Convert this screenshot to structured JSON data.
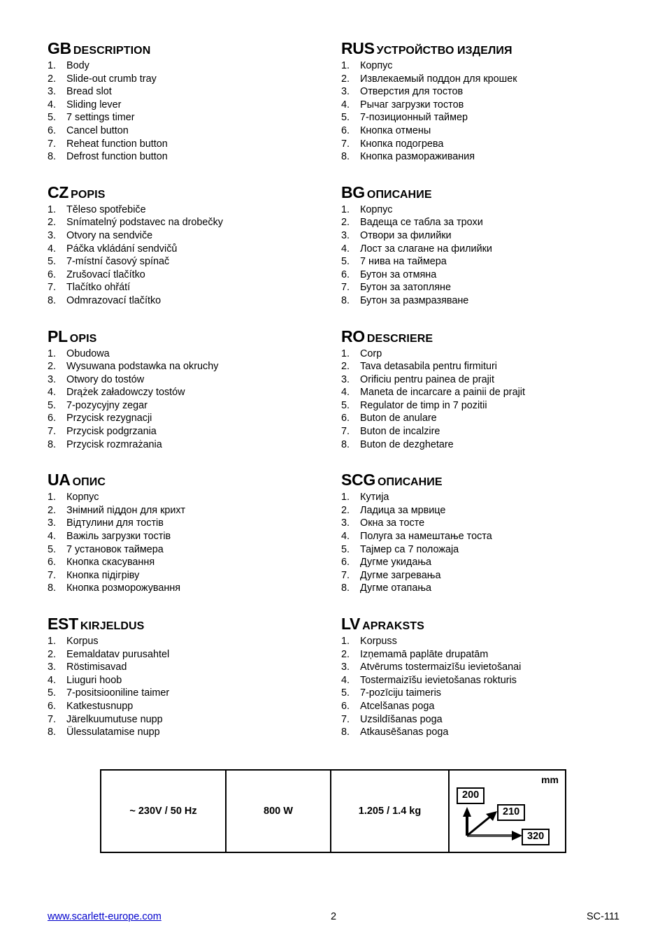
{
  "document": {
    "sections": [
      {
        "code": "GB",
        "title": "DESCRIPTION",
        "items": [
          "Body",
          "Slide-out crumb tray",
          "Bread slot",
          "Sliding lever",
          "7 settings timer",
          "Cancel button",
          "Reheat function button",
          "Defrost function button"
        ]
      },
      {
        "code": "RUS",
        "title": "УСТРОЙСТВО ИЗДЕЛИЯ",
        "items": [
          "Корпус",
          "Извлекаемый поддон для крошек",
          "Отверстия для тостов",
          "Рычаг загрузки тостов",
          "7-позиционный таймер",
          "Кнопка отмены",
          "Кнопка подогрева",
          "Кнопка размораживания"
        ]
      },
      {
        "code": "CZ",
        "title": "POPIS",
        "items": [
          "Těleso spotřebiče",
          "Snímatelný podstavec na drobečky",
          "Otvory na sendviče",
          "Páčka vkládání sendvičů",
          "7-místní časový spínač",
          "Zrušovací tlačítko",
          "Tlačítko ohřátí",
          "Odmrazovací tlačítko"
        ]
      },
      {
        "code": "BG",
        "title": "ОПИСАНИЕ",
        "items": [
          "Корпус",
          "Вадеща се табла за трохи",
          "Отвори за филийки",
          "Лост за слагане на филийки",
          "7 нива на таймера",
          "Бутон за отмяна",
          "Бутон за затопляне",
          "Бутон за размразяване"
        ]
      },
      {
        "code": "PL",
        "title": "OPIS",
        "items": [
          "Obudowa",
          "Wysuwana podstawka na okruchy",
          "Otwory do tostów",
          "Drążek załadowczy tostów",
          "7-pozycyjny zegar",
          "Przycisk rezygnacji",
          "Przycisk podgrzania",
          "Przycisk rozmrażania"
        ]
      },
      {
        "code": "RO",
        "title": "DESCRIERE",
        "items": [
          "Corp",
          "Tava detasabila pentru firmituri",
          "Orificiu pentru painea de prajit",
          "Maneta de incarcare a painii de prajit",
          "Regulator de timp in 7 pozitii",
          "Buton de anulare",
          "Buton de incalzire",
          "Buton de dezghetare"
        ]
      },
      {
        "code": "UA",
        "title": "ОПИС",
        "items": [
          "Корпус",
          "Знімний піддон для крихт",
          "Відтулини для тостів",
          "Важіль загрузки тостів",
          "7 установок таймера",
          "Кнопка скасування",
          "Кнопка підігріву",
          "Кнопка розморожування"
        ]
      },
      {
        "code": "SCG",
        "title": "ОПИСАНИЕ",
        "items": [
          "Кутија",
          "Ладица за мрвице",
          "Окна за тосте",
          "Полуга за намештање тоста",
          "Тајмер са 7 положаја",
          "Дугме укидања",
          "Дугме загревања",
          "Дугме отапања"
        ]
      },
      {
        "code": "EST",
        "title": "KIRJELDUS",
        "items": [
          "Korpus",
          "Eemaldatav purusahtel",
          "Röstimisavad",
          "Liuguri hoob",
          "7-positsiooniline taimer",
          "Katkestusnupp",
          "Järelkuumutuse nupp",
          "Ülessulatamise nupp"
        ]
      },
      {
        "code": "LV",
        "title": "APRAKSTS",
        "items": [
          "Korpuss",
          "Izņemamā paplāte drupatām",
          "Atvērums tostermaizīšu ievietošanai",
          "Tostermaizīšu ievietošanas rokturis",
          "7-pozīciju taimeris",
          "Atcelšanas poga",
          "Uzsildīšanas poga",
          "Atkausēšanas poga"
        ]
      }
    ]
  },
  "spec_table": {
    "voltage": "~ 230V / 50 Hz",
    "power": "800 W",
    "weight": "1.205 / 1.4 kg",
    "dimensions": {
      "unit": "mm",
      "height": "200",
      "depth": "210",
      "width": "320"
    }
  },
  "footer": {
    "url": "www.scarlett-europe.com",
    "page": "2",
    "model": "SC-111",
    "link_color": "#0000cc"
  }
}
